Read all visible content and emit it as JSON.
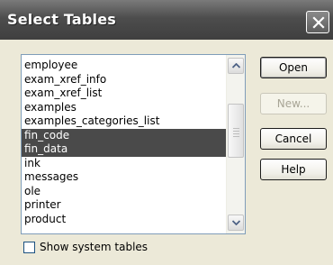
{
  "dialog": {
    "title": "Select Tables"
  },
  "table_list": {
    "items": [
      {
        "label": "employee",
        "selected": false
      },
      {
        "label": "exam_xref_info",
        "selected": false
      },
      {
        "label": "exam_xref_list",
        "selected": false
      },
      {
        "label": "examples",
        "selected": false
      },
      {
        "label": "examples_categories_list",
        "selected": false
      },
      {
        "label": "fin_code",
        "selected": true
      },
      {
        "label": "fin_data",
        "selected": true
      },
      {
        "label": "ink",
        "selected": false
      },
      {
        "label": "messages",
        "selected": false
      },
      {
        "label": "ole",
        "selected": false
      },
      {
        "label": "printer",
        "selected": false
      },
      {
        "label": "product",
        "selected": false
      }
    ]
  },
  "buttons": {
    "open": "Open",
    "new": "New...",
    "cancel": "Cancel",
    "help": "Help"
  },
  "show_system_tables": {
    "label": "Show system tables",
    "checked": false
  },
  "colors": {
    "selection": "#4a4a4a",
    "titlebar": "#4d4d4d",
    "dialog_bg": "#ece9d8"
  }
}
